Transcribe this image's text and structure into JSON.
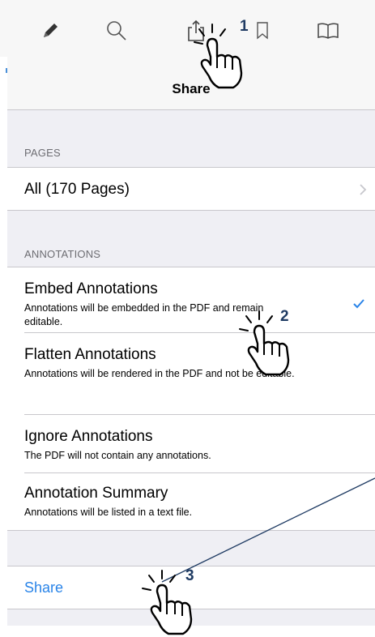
{
  "toolbar": {
    "icons": [
      "pencil-icon",
      "search-icon",
      "share-icon",
      "bookmark-icon",
      "book-icon"
    ]
  },
  "popover": {
    "title": "Share",
    "pages_section": {
      "header": "PAGES",
      "item_label": "All (170 Pages)"
    },
    "annotations_section": {
      "header": "ANNOTATIONS",
      "options": [
        {
          "title": "Embed Annotations",
          "subtitle": "Annotations will be embedded in the PDF and remain editable.",
          "selected": true
        },
        {
          "title": "Flatten Annotations",
          "subtitle": "Annotations will be rendered in the PDF and not be editable.",
          "selected": false
        },
        {
          "title": "Ignore Annotations",
          "subtitle": "The PDF will not contain any annotations.",
          "selected": false
        },
        {
          "title": "Annotation Summary",
          "subtitle": "Annotations will be listed in a text file.",
          "selected": false
        }
      ]
    },
    "share_label": "Share"
  },
  "steps": [
    "1",
    "2",
    "3"
  ],
  "colors": {
    "accent": "#2a84e8",
    "step_number": "#1f3b63",
    "group_bg": "#efeff4"
  }
}
